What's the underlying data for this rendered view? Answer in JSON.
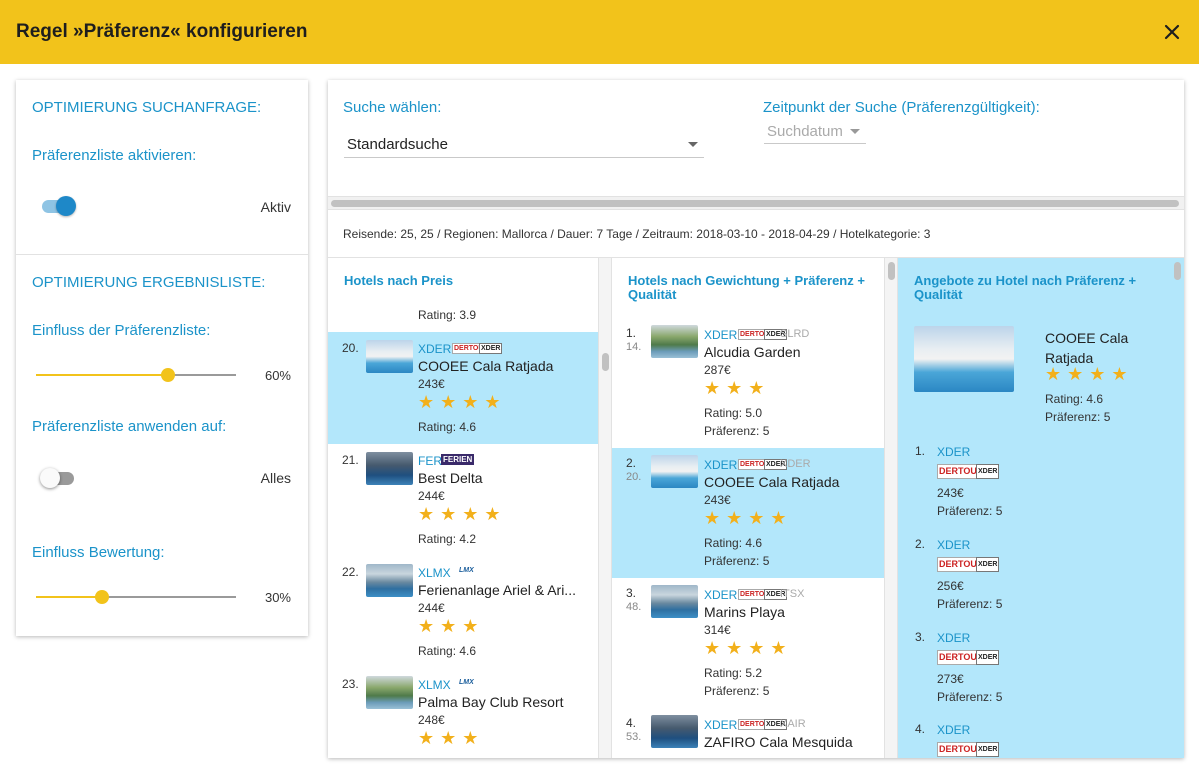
{
  "dialog": {
    "title": "Regel »Präferenz« konfigurieren",
    "close_icon": "close-icon"
  },
  "left": {
    "section1_title": "OPTIMIERUNG SUCHANFRAGE:",
    "activate_label": "Präferenzliste aktivieren:",
    "activate_state": "Aktiv",
    "section2_title": "OPTIMIERUNG ERGEBNISLISTE:",
    "influence_label": "Einfluss der Präferenzliste:",
    "influence_value": "60%",
    "influence_fraction": 0.66,
    "apply_label": "Präferenzliste anwenden auf:",
    "apply_state": "Alles",
    "rating_label": "Einfluss Bewertung:",
    "rating_value": "30%",
    "rating_fraction": 0.33
  },
  "search": {
    "select_label": "Suche wählen:",
    "select_value": "Standardsuche",
    "time_label": "Zeitpunkt der Suche (Präferenzgültigkeit):",
    "time_value": "Suchdatum",
    "summary": "Reisende: 25, 25 / Regionen: Mallorca / Dauer: 7 Tage / Zeitraum: 2018-03-10 - 2018-04-29 / Hotelkategorie: 3"
  },
  "col1": {
    "head": "Hotels nach Preis",
    "top_rating": "Rating: 3.9",
    "items": [
      {
        "rank": "20.",
        "op": "XDER",
        "name": "COOEE Cala Ratjada",
        "price": "243€",
        "stars": "★★★★",
        "rating": "Rating: 4.6"
      },
      {
        "rank": "21.",
        "op": "FER",
        "name": "Best Delta",
        "price": "244€",
        "stars": "★★★★",
        "rating": "Rating: 4.2"
      },
      {
        "rank": "22.",
        "op": "XLMX",
        "name": "Ferienanlage Ariel & Ari...",
        "price": "244€",
        "stars": "★★★",
        "rating": "Rating: 4.6"
      },
      {
        "rank": "23.",
        "op": "XLMX",
        "name": "Palma Bay Club Resort",
        "price": "248€",
        "stars": "★★★",
        "rating": ""
      }
    ]
  },
  "col2": {
    "head": "Hotels nach Gewichtung + Präferenz + Qualität",
    "items": [
      {
        "rank": "1.",
        "rank2": "14.",
        "op": "XDER",
        "op2": "SLRD",
        "name": "Alcudia Garden",
        "price": "287€",
        "stars": "★★★",
        "rating": "Rating: 5.0",
        "pref": "Präferenz: 5"
      },
      {
        "rank": "2.",
        "rank2": "20.",
        "op": "XDER",
        "op2": "XDER",
        "name": "COOEE Cala Ratjada",
        "price": "243€",
        "stars": "★★★★",
        "rating": "Rating: 4.6",
        "pref": "Präferenz: 5"
      },
      {
        "rank": "3.",
        "rank2": "48.",
        "op": "XDER",
        "op2": "ITSX",
        "name": "Marins Playa",
        "price": "314€",
        "stars": "★★★★",
        "rating": "Rating: 5.2",
        "pref": "Präferenz: 5"
      },
      {
        "rank": "4.",
        "rank2": "53.",
        "op": "XDER",
        "op2": "XAIR",
        "name": "ZAFIRO Cala Mesquida",
        "price": "",
        "stars": "",
        "rating": "",
        "pref": ""
      }
    ]
  },
  "col3": {
    "head": "Angebote zu Hotel nach Präferenz + Qualität",
    "hotel_name": "COOEE Cala Ratjada",
    "stars": "★★★★",
    "rating": "Rating: 4.6",
    "pref": "Präferenz: 5",
    "offers": [
      {
        "rank": "1.",
        "op": "XDER",
        "price": "243€",
        "pref": "Präferenz: 5"
      },
      {
        "rank": "2.",
        "op": "XDER",
        "price": "256€",
        "pref": "Präferenz: 5"
      },
      {
        "rank": "3.",
        "op": "XDER",
        "price": "273€",
        "pref": "Präferenz: 5"
      },
      {
        "rank": "4.",
        "op": "XDER",
        "price": "",
        "pref": ""
      }
    ]
  },
  "logos": {
    "dertour": "DERTOUR",
    "xder": "XDER",
    "ferien": "FERIEN",
    "lmx": "LMX"
  },
  "colors": {
    "accent": "#f2c31b",
    "link": "#1b93c9",
    "selected": "#b3e7fb",
    "star": "#f2b01b"
  }
}
